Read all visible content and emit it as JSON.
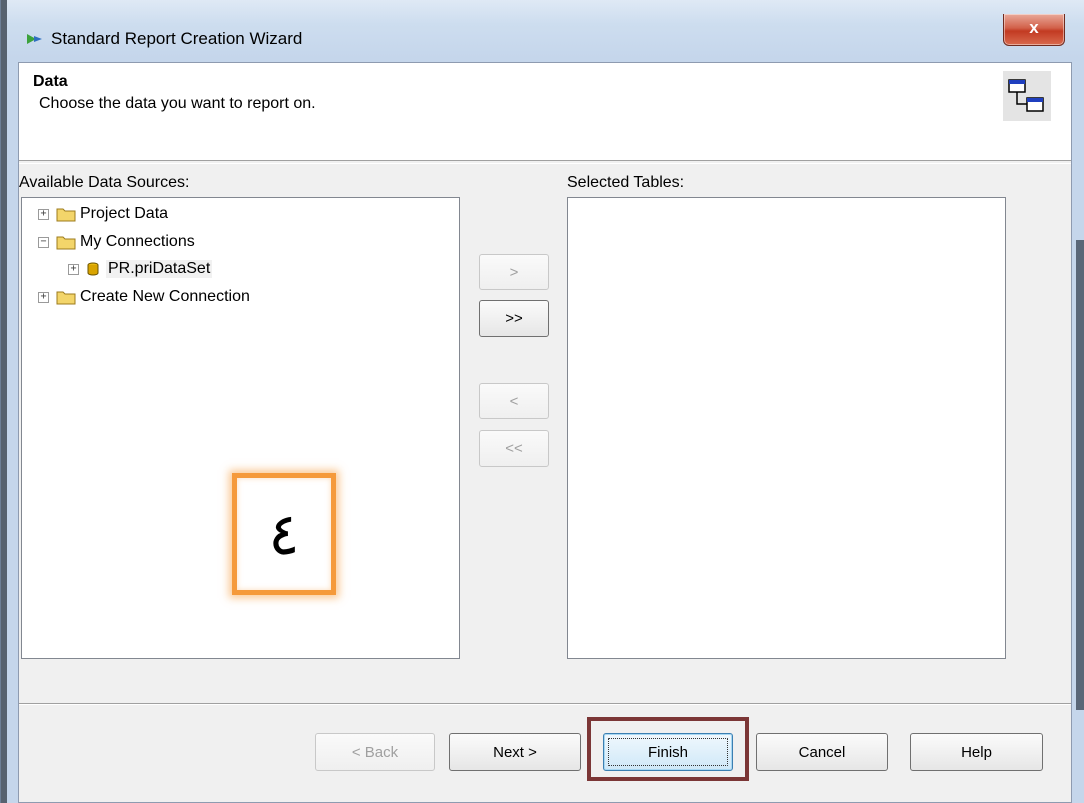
{
  "window": {
    "title": "Standard Report Creation Wizard",
    "close_label": "x"
  },
  "header": {
    "title": "Data",
    "subtitle": "Choose the data you want to report on."
  },
  "available": {
    "label": "Available Data Sources:",
    "items": [
      {
        "expander": "+",
        "label": "Project Data"
      },
      {
        "expander": "−",
        "label": "My Connections"
      },
      {
        "expander": "+",
        "label": "PR.priDataSet"
      },
      {
        "expander": "+",
        "label": "Create New Connection"
      }
    ]
  },
  "selected": {
    "label": "Selected Tables:"
  },
  "transfer": {
    "add": ">",
    "add_all": ">>",
    "remove": "<",
    "remove_all": "<<"
  },
  "annotation": {
    "number": "٤",
    "color": "#f59a3b"
  },
  "footer": {
    "back": "< Back",
    "next": "Next >",
    "finish": "Finish",
    "cancel": "Cancel",
    "help": "Help",
    "highlight_color": "#7b3636"
  }
}
